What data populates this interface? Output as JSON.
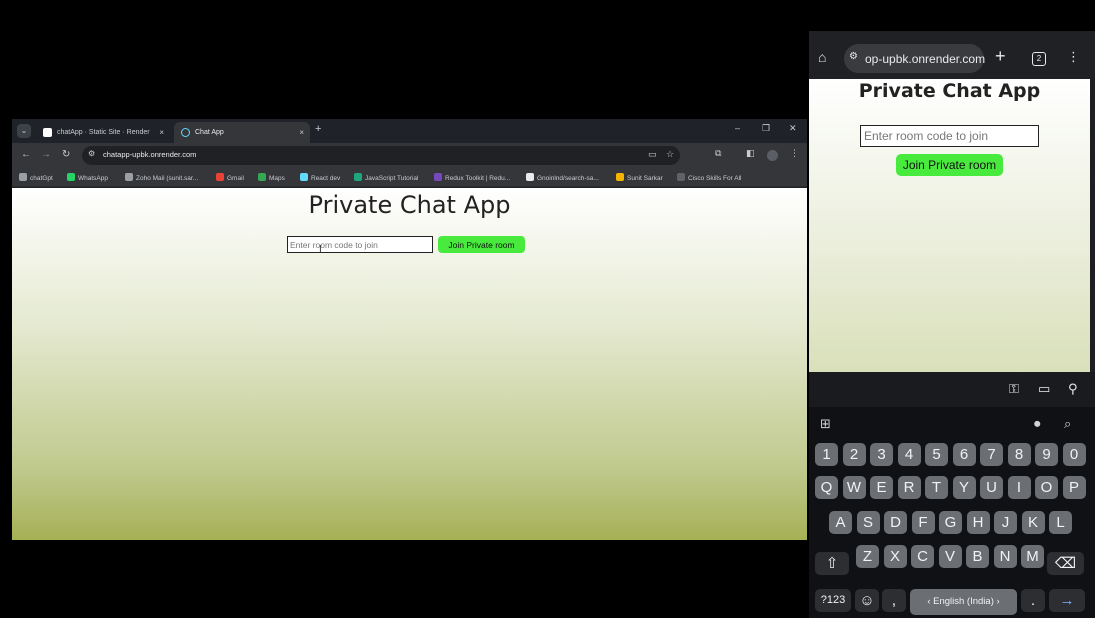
{
  "desktop": {
    "tabs": [
      {
        "title": "chatApp · Static Site · Render Da",
        "close": "×",
        "active": false
      },
      {
        "title": "Chat App",
        "close": "×",
        "active": true
      }
    ],
    "new_tab": "+",
    "window_controls": {
      "minimize": "–",
      "maximize": "❐",
      "close": "✕"
    },
    "address": "chatapp-upbk.onrender.com",
    "bookmarks": [
      {
        "label": "chatGpt",
        "color": "#9aa0a6"
      },
      {
        "label": "WhatsApp",
        "color": "#25d366"
      },
      {
        "label": "Zoho Mail (sunit.sar...",
        "color": "#9aa0a6"
      },
      {
        "label": "Gmail",
        "color": "#ea4335"
      },
      {
        "label": "Maps",
        "color": "#34a853"
      },
      {
        "label": "React dev",
        "color": "#61dafb"
      },
      {
        "label": "JavaScript Tutorial",
        "color": "#1fa67a"
      },
      {
        "label": "Redux Toolkit | Redu...",
        "color": "#764abc"
      },
      {
        "label": "Gnoinlnd/search-sa...",
        "color": "#e8eaed"
      },
      {
        "label": "Sunit Sarkar",
        "color": "#f5b400"
      },
      {
        "label": "Cisco Skills For All",
        "color": "#5f6368"
      }
    ],
    "page": {
      "title": "Private Chat App",
      "input_placeholder": "Enter room code to join",
      "join_label": "Join Private room"
    }
  },
  "phone": {
    "address": "op-upbk.onrender.com",
    "tab_count": "2",
    "page": {
      "title": "Private Chat App",
      "input_placeholder": "Enter room code to join",
      "join_label": "Join Private room"
    },
    "keyboard": {
      "row_numbers": [
        "1",
        "2",
        "3",
        "4",
        "5",
        "6",
        "7",
        "8",
        "9",
        "0"
      ],
      "row1": [
        "Q",
        "W",
        "E",
        "R",
        "T",
        "Y",
        "U",
        "I",
        "O",
        "P"
      ],
      "row2": [
        "A",
        "S",
        "D",
        "F",
        "G",
        "H",
        "J",
        "K",
        "L"
      ],
      "row3": [
        "Z",
        "X",
        "C",
        "V",
        "B",
        "N",
        "M"
      ],
      "symbols_key": "?123",
      "comma_key": ",",
      "space_label": "‹  English (India)  ›",
      "period_key": "."
    }
  },
  "colors": {
    "accent_green": "#49ea3e",
    "chrome_dark": "#202124"
  }
}
